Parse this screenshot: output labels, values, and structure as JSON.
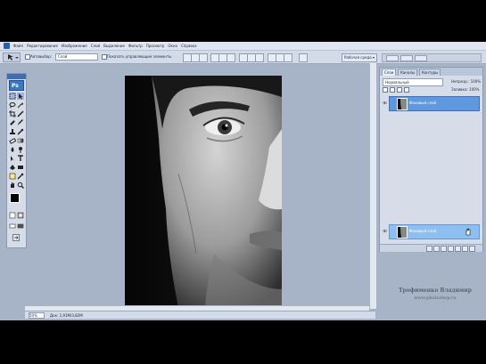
{
  "menubar": {
    "items": [
      "Файл",
      "Редактирование",
      "Изображение",
      "Слой",
      "Выделение",
      "Фильтр",
      "Просмотр",
      "Окно",
      "Справка"
    ]
  },
  "options": {
    "autoselect_label": "Автовыбор:",
    "autoselect_value": "Слой",
    "show_controls_label": "Показать управляющие элементы",
    "workspace_label": "Рабочая среда ▾"
  },
  "status": {
    "zoom": "50%",
    "doc": "Док: 1,91M/3,82M"
  },
  "layers_panel": {
    "tabs": [
      "Слои",
      "Каналы",
      "Контуры"
    ],
    "blend_mode": "Нормальный",
    "opacity_label": "Непрозр.:",
    "opacity_value": "100%",
    "fill_label": "Заливка:",
    "fill_value": "100%",
    "layers": [
      {
        "name": "Фоновый слой"
      },
      {
        "name": "Фоновый слой"
      }
    ]
  },
  "watermark": {
    "line1": "Трофименко Владимир",
    "line2": "www.photoshop.ru"
  },
  "colors": {
    "app_bg": "#a7b3c6",
    "selection": "#5f98de",
    "canvas_bg": "#c4c4c4"
  }
}
